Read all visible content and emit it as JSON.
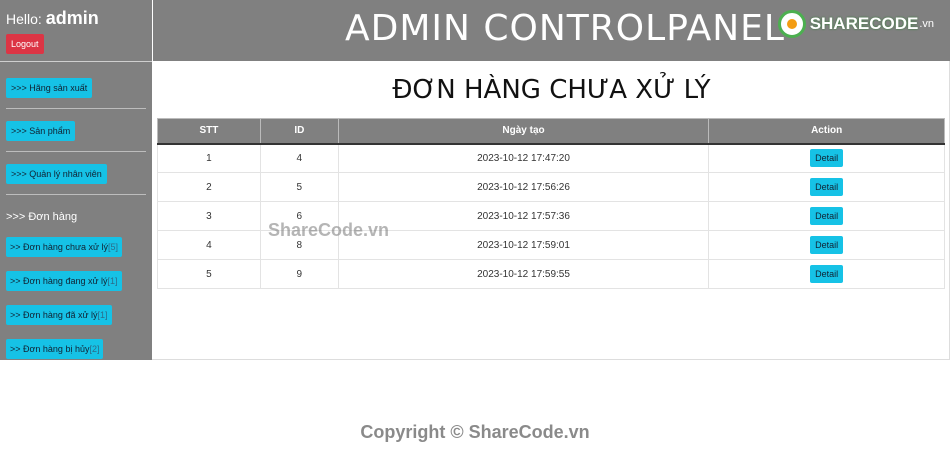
{
  "user": {
    "greeting": "Hello:",
    "name": "admin",
    "logout_label": "Logout"
  },
  "header": {
    "title": "ADMIN CONTROLPANEL",
    "logo_text": "SHARECODE",
    "logo_suffix": ".vn"
  },
  "sidebar": {
    "items": [
      {
        "label": ">>> Hãng sản xuất"
      },
      {
        "label": ">>> Sản phẩm"
      },
      {
        "label": ">>> Quản lý nhân viên"
      }
    ],
    "group_label": ">>> Đơn hàng",
    "sub_items": [
      {
        "label": ">> Đơn hàng chưa xử lý",
        "count": "[5]"
      },
      {
        "label": ">> Đơn hàng đang xử lý",
        "count": "[1]"
      },
      {
        "label": ">> Đơn hàng đã xử lý",
        "count": "[1]"
      },
      {
        "label": ">> Đơn hàng bị hủy",
        "count": "[2]"
      }
    ]
  },
  "main": {
    "title": "ĐƠN HÀNG CHƯA XỬ LÝ",
    "columns": [
      "STT",
      "ID",
      "Ngày tạo",
      "Action"
    ],
    "detail_label": "Detail",
    "rows": [
      {
        "stt": "1",
        "id": "4",
        "date": "2023-10-12 17:47:20"
      },
      {
        "stt": "2",
        "id": "5",
        "date": "2023-10-12 17:56:26"
      },
      {
        "stt": "3",
        "id": "6",
        "date": "2023-10-12 17:57:36"
      },
      {
        "stt": "4",
        "id": "8",
        "date": "2023-10-12 17:59:01"
      },
      {
        "stt": "5",
        "id": "9",
        "date": "2023-10-12 17:59:55"
      }
    ]
  },
  "watermark": "ShareCode.vn",
  "copyright": "Copyright © ShareCode.vn"
}
